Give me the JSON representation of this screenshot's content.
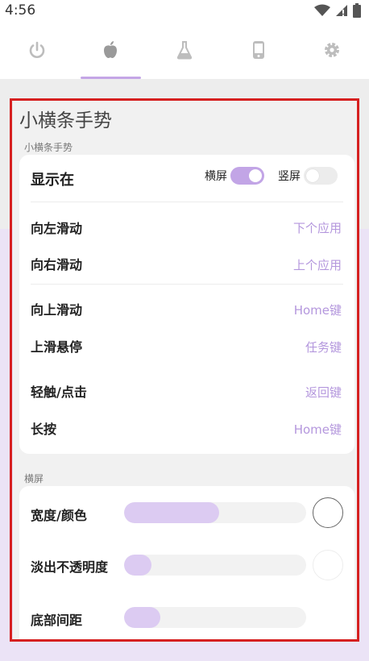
{
  "status_bar": {
    "time": "4:56"
  },
  "tabs": [
    {
      "icon": "power-icon",
      "active": false
    },
    {
      "icon": "apple-icon",
      "active": true
    },
    {
      "icon": "flask-icon",
      "active": false
    },
    {
      "icon": "phone-icon",
      "active": false
    },
    {
      "icon": "gear-icon",
      "active": false
    }
  ],
  "page": {
    "title": "小横条手势"
  },
  "section1": {
    "label": "小横条手势",
    "show_on": {
      "label": "显示在",
      "landscape_label": "横屏",
      "landscape_on": true,
      "portrait_label": "竖屏",
      "portrait_on": false
    },
    "gestures": [
      {
        "label": "向左滑动",
        "value": "下个应用"
      },
      {
        "label": "向右滑动",
        "value": "上个应用"
      },
      {
        "label": "向上滑动",
        "value": "Home键"
      },
      {
        "label": "上滑悬停",
        "value": "任务键"
      },
      {
        "label": "轻触/点击",
        "value": "返回键"
      },
      {
        "label": "长按",
        "value": "Home键"
      }
    ]
  },
  "section2": {
    "label": "横屏",
    "sliders": [
      {
        "label": "宽度/颜色",
        "fraction": 0.52
      },
      {
        "label": "淡出不透明度",
        "fraction": 0.15
      },
      {
        "label": "底部间距",
        "fraction": 0.2
      }
    ]
  },
  "colors": {
    "accent": "#c2a5e6",
    "value_text": "#b497dd",
    "frame": "#d62020"
  }
}
